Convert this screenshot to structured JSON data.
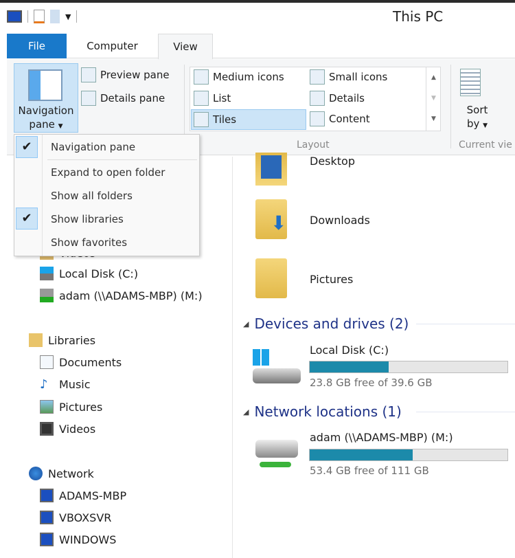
{
  "window": {
    "title": "This PC"
  },
  "tabs": [
    {
      "label": "File"
    },
    {
      "label": "Computer"
    },
    {
      "label": "View"
    }
  ],
  "ribbon": {
    "navigation_pane": "Navigation",
    "navigation_pane2": "pane",
    "preview_pane": "Preview pane",
    "details_pane": "Details pane",
    "layout": [
      "Medium icons",
      "Small icons",
      "List",
      "Details",
      "Tiles",
      "Content"
    ],
    "layout_selected": "Tiles",
    "layout_group": "Layout",
    "sort": "Sort",
    "sort2": "by",
    "current_view_group": "Current vie"
  },
  "menu": {
    "items": [
      {
        "label": "Navigation pane",
        "checked": true
      },
      {
        "label": "Expand to open folder",
        "checked": false
      },
      {
        "label": "Show all folders",
        "checked": false
      },
      {
        "label": "Show libraries",
        "checked": true
      },
      {
        "label": "Show favorites",
        "checked": false
      }
    ]
  },
  "nav": {
    "items": [
      {
        "label": "Videos"
      },
      {
        "label": "Local Disk (C:)"
      },
      {
        "label": "adam (\\\\ADAMS-MBP) (M:)"
      },
      {
        "label": "Libraries"
      },
      {
        "label": "Documents"
      },
      {
        "label": "Music"
      },
      {
        "label": "Pictures"
      },
      {
        "label": "Videos"
      },
      {
        "label": "Network"
      },
      {
        "label": "ADAMS-MBP"
      },
      {
        "label": "VBOXSVR"
      },
      {
        "label": "WINDOWS"
      }
    ]
  },
  "content": {
    "folders": [
      {
        "name": "Desktop"
      },
      {
        "name": "Downloads"
      },
      {
        "name": "Pictures"
      }
    ],
    "devices_header": "Devices and drives (2)",
    "network_header": "Network locations (1)",
    "drives": [
      {
        "name": "Local Disk (C:)",
        "free": "23.8 GB free of 39.6 GB",
        "used_percent": 40
      },
      {
        "name": "adam (\\\\ADAMS-MBP) (M:)",
        "free": "53.4 GB free of 111 GB",
        "used_percent": 52
      }
    ]
  },
  "colors": {
    "accent": "#1979ca",
    "bar_fill": "#1c8aaa",
    "header": "#1e3287"
  }
}
